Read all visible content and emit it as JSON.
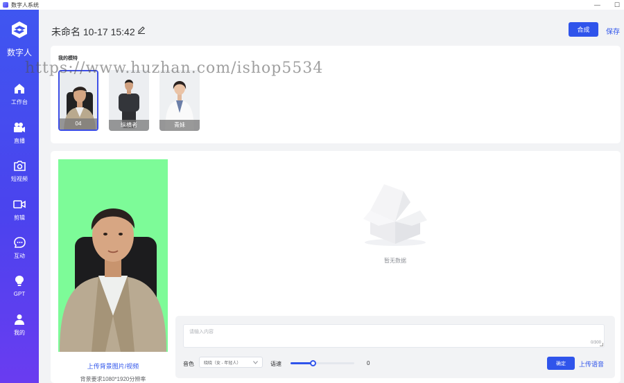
{
  "window": {
    "title": "数字人系统",
    "min_glyph": "—",
    "max_glyph": "☐"
  },
  "sidebar": {
    "logo_text": "数字人",
    "items": [
      {
        "label": "工作台",
        "icon": "home-icon"
      },
      {
        "label": "直播",
        "icon": "video-camera-icon"
      },
      {
        "label": "短视频",
        "icon": "camera-icon"
      },
      {
        "label": "剪辑",
        "icon": "video-icon"
      },
      {
        "label": "互动",
        "icon": "chat-icon"
      },
      {
        "label": "GPT",
        "icon": "bulb-icon"
      },
      {
        "label": "我的",
        "icon": "user-icon"
      }
    ]
  },
  "header": {
    "title": "未命名 10-17 15:42",
    "compose_label": "合成",
    "save_label": "保存"
  },
  "models": {
    "title": "我的模特",
    "items": [
      {
        "name": "04",
        "selected": true
      },
      {
        "name": "纵横者",
        "selected": false
      },
      {
        "name": "青妹",
        "selected": false
      }
    ]
  },
  "watermark": "https://www.huzhan.com/ishop5534",
  "preview": {
    "bg_color": "#7dfb98",
    "upload_label": "上传背景图片/视频",
    "requirement": "背景要求1080*1920分辨率"
  },
  "empty_state": {
    "text": "暂无数据"
  },
  "input": {
    "placeholder": "请输入内容",
    "counter": "0/300",
    "voice_label": "音色",
    "voice_value": "晓晓（女 - 年轻人）",
    "speed_label": "语速",
    "speed_value": "0",
    "speed_fraction": 0.35,
    "confirm_label": "确定",
    "upload_voice_label": "上传语音"
  },
  "colors": {
    "accent": "#2f54eb",
    "sidebar_top": "#3f56f0",
    "sidebar_bottom": "#6a3cf0"
  }
}
